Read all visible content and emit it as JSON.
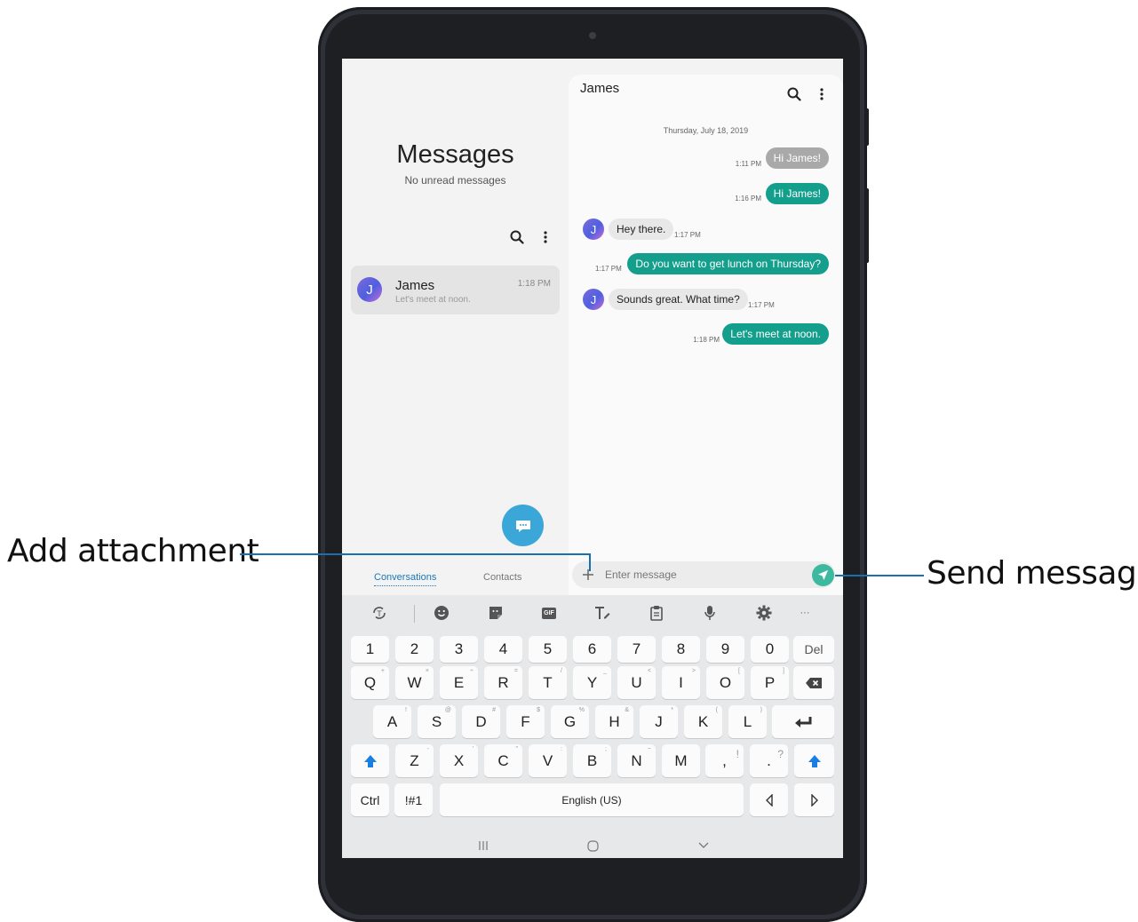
{
  "annotations": {
    "add_attachment": "Add attachment",
    "send_message": "Send message"
  },
  "left_pane": {
    "title": "Messages",
    "subtitle": "No unread messages",
    "conversation": {
      "avatar_letter": "J",
      "name": "James",
      "preview": "Let's meet at noon.",
      "time": "1:18 PM"
    },
    "tabs": {
      "conversations": "Conversations",
      "contacts": "Contacts"
    }
  },
  "chat": {
    "contact_name": "James",
    "date": "Thursday, July 18, 2019",
    "messages": [
      {
        "text": "Hi James!",
        "time": "1:11 PM",
        "dir": "out-grey"
      },
      {
        "text": "Hi James!",
        "time": "1:16 PM",
        "dir": "out"
      },
      {
        "text": "Hey there.",
        "time": "1:17 PM",
        "dir": "in",
        "avatar": "J"
      },
      {
        "text": "Do you want to get lunch on Thursday?",
        "time": "1:17 PM",
        "dir": "out"
      },
      {
        "text": "Sounds great. What time?",
        "time": "1:17 PM",
        "dir": "in",
        "avatar": "J"
      },
      {
        "text": "Let's meet at noon.",
        "time": "1:18 PM",
        "dir": "out"
      }
    ],
    "input_placeholder": "Enter message"
  },
  "keyboard": {
    "toolbar_more": "···",
    "toolbar_gif": "GIF",
    "number_row": [
      "1",
      "2",
      "3",
      "4",
      "5",
      "6",
      "7",
      "8",
      "9",
      "0"
    ],
    "del_label": "Del",
    "row1": [
      "Q",
      "W",
      "E",
      "R",
      "T",
      "Y",
      "U",
      "I",
      "O",
      "P"
    ],
    "row1_sup": [
      "+",
      "×",
      "÷",
      "=",
      "/",
      "_",
      "<",
      ">",
      "[",
      "]"
    ],
    "row2": [
      "A",
      "S",
      "D",
      "F",
      "G",
      "H",
      "J",
      "K",
      "L"
    ],
    "row2_sup": [
      "!",
      "@",
      "#",
      "$",
      "%",
      "&",
      "*",
      "(",
      ")"
    ],
    "row3": [
      "Z",
      "X",
      "C",
      "V",
      "B",
      "N",
      "M"
    ],
    "row3_sup": [
      "-",
      "'",
      "\"",
      ":",
      ";",
      "~",
      ""
    ],
    "comma_key": ",",
    "comma_sup": "!",
    "period_key": ".",
    "period_sup": "?",
    "ctrl_label": "Ctrl",
    "sym_label": "!#1",
    "space_label": "English (US)"
  },
  "colors": {
    "accent_teal": "#149e8c",
    "fab_blue": "#3aa7d8",
    "shift_blue": "#1a7fe0",
    "annotation_line": "#1a6fb0"
  }
}
